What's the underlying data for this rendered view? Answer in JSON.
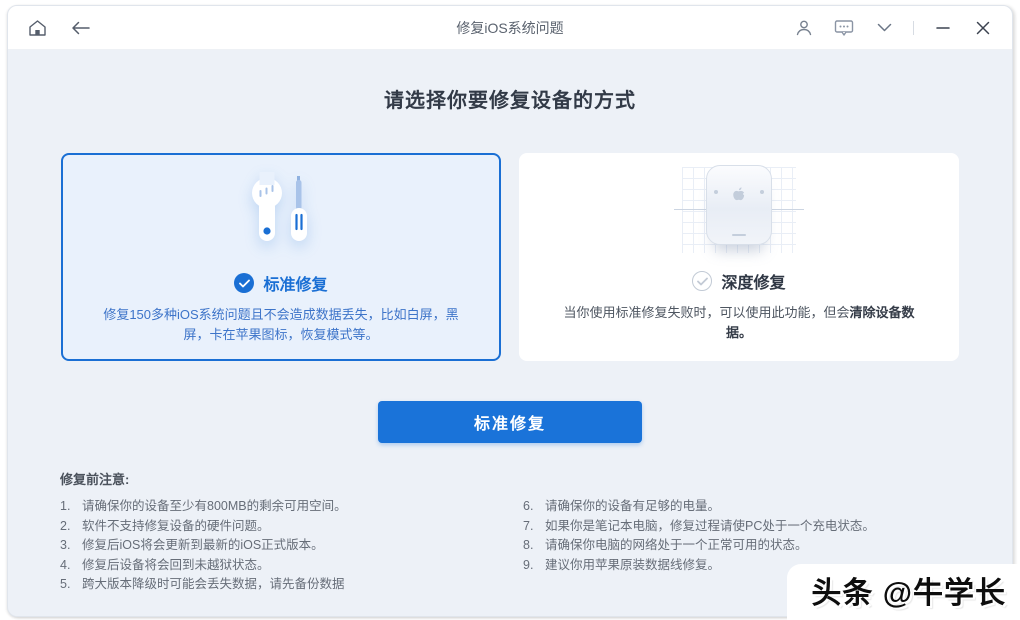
{
  "titlebar": {
    "title": "修复iOS系统问题"
  },
  "heading": "请选择你要修复设备的方式",
  "cards": {
    "standard": {
      "title": "标准修复",
      "description": "修复150多种iOS系统问题且不会造成数据丢失，比如白屏，黑屏，卡在苹果图标，恢复模式等。",
      "selected": true
    },
    "deep": {
      "title": "深度修复",
      "description_prefix": "当你使用标准修复失败时，可以使用此功能，但会",
      "description_bold": "清除设备数据。",
      "selected": false
    }
  },
  "action_button": {
    "label": "标准修复"
  },
  "notes": {
    "title": "修复前注意:",
    "left": [
      "请确保你的设备至少有800MB的剩余可用空间。",
      "软件不支持修复设备的硬件问题。",
      "修复后iOS将会更新到最新的iOS正式版本。",
      "修复后设备将会回到未越狱状态。",
      "跨大版本降级时可能会丢失数据，请先备份数据"
    ],
    "right": [
      "请确保你的设备有足够的电量。",
      "如果你是笔记本电脑，修复过程请使PC处于一个充电状态。",
      "请确保你电脑的网络处于一个正常可用的状态。",
      "建议你用苹果原装数据线修复。"
    ]
  },
  "watermark": "头条 @牛学长",
  "colors": {
    "accent": "#1a6fd4",
    "selected_card_bg": "#e9f1fc",
    "body_bg": "#edf1f7",
    "button_bg": "#1a73d9"
  }
}
